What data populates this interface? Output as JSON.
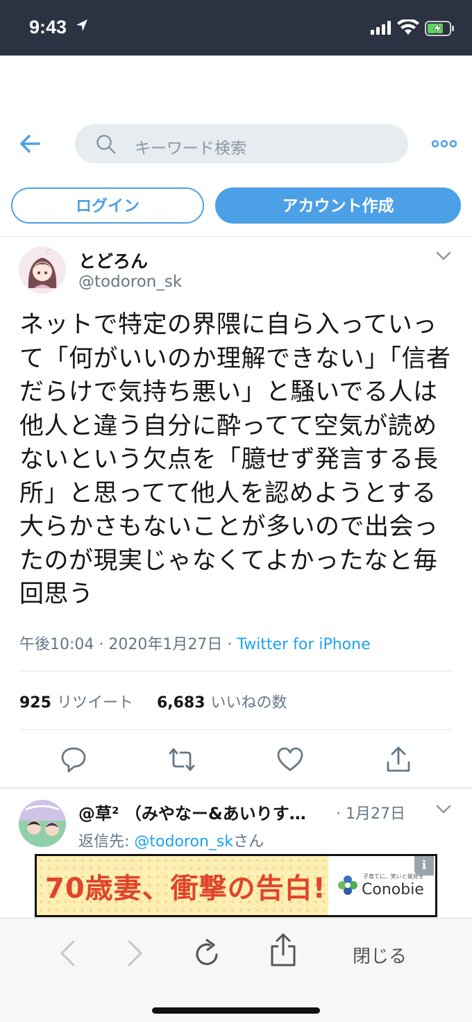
{
  "status_bar": {
    "time": "9:43"
  },
  "search": {
    "placeholder": "キーワード検索"
  },
  "buttons": {
    "login": "ログイン",
    "signup": "アカウント作成"
  },
  "tweet": {
    "author_name": "とどろん",
    "author_handle": "@todoron_sk",
    "text": "ネットで特定の界隈に自ら入っていって「何がいいのか理解できない」「信者だらけで気持ち悪い」と騒いでる人は他人と違う自分に酔ってて空気が読めないという欠点を「臆せず発言する長所」と思ってて他人を認めようとする大らかさもないことが多いので出会ったのが現実じゃなくてよかったなと毎回思う",
    "time": "午後10:04",
    "date": "2020年1月27日",
    "source": "Twitter for iPhone",
    "retweets": "925",
    "retweets_label": "リツイート",
    "likes": "6,683",
    "likes_label": "いいねの数"
  },
  "reply": {
    "author": "@草² （みやなー&あいりす…",
    "date": "· 1月27日",
    "reply_prefix": "返信先: ",
    "reply_to": "@todoron_sk",
    "reply_suffix": "さん"
  },
  "ad": {
    "headline": "70歳妻、衝撃の告白!",
    "brand": "Conobie",
    "tagline": "子育てに、笑いと発見を",
    "info": "i"
  },
  "browser": {
    "close_label": "閉じる"
  },
  "colors": {
    "accent": "#4ba0e6",
    "link": "#1da1f2",
    "statusbar": "#2b3241",
    "muted": "#657786"
  }
}
